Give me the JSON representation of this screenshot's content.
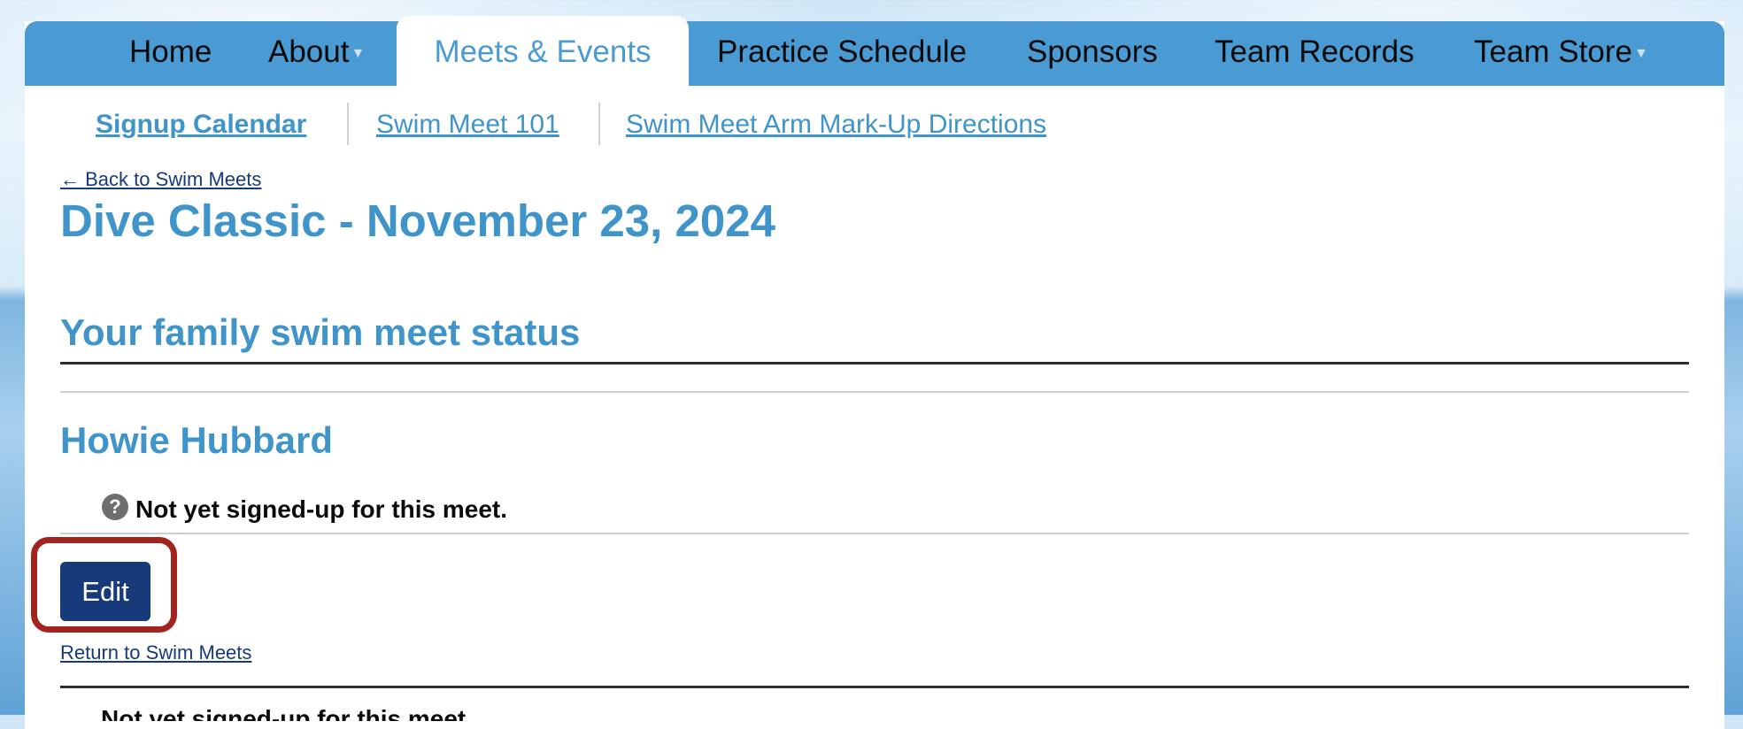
{
  "nav": {
    "items": [
      {
        "label": "Home",
        "has_dropdown": false
      },
      {
        "label": "About",
        "has_dropdown": true
      },
      {
        "label": "Meets & Events",
        "active": true
      },
      {
        "label": "Practice Schedule"
      },
      {
        "label": "Sponsors"
      },
      {
        "label": "Team Records"
      },
      {
        "label": "Team Store",
        "has_dropdown": true
      }
    ]
  },
  "subnav": {
    "items": [
      {
        "label": "Signup Calendar",
        "current": true
      },
      {
        "label": "Swim Meet 101"
      },
      {
        "label": "Swim Meet Arm Mark-Up Directions"
      }
    ]
  },
  "back_link": "← Back to Swim Meets",
  "page_title": "Dive Classic - November 23, 2024",
  "status_section": {
    "heading": "Your family swim meet status",
    "member_name": "Howie Hubbard",
    "status_icon": "question-circle-icon",
    "status_text": "Not yet signed-up for this meet."
  },
  "edit_button": "Edit",
  "return_link": "Return to Swim Meets",
  "colors": {
    "nav_bar": "#4a9ad4",
    "heading_blue": "#3f94c9",
    "button_navy": "#163a7a",
    "highlight_red": "#a3241f"
  }
}
